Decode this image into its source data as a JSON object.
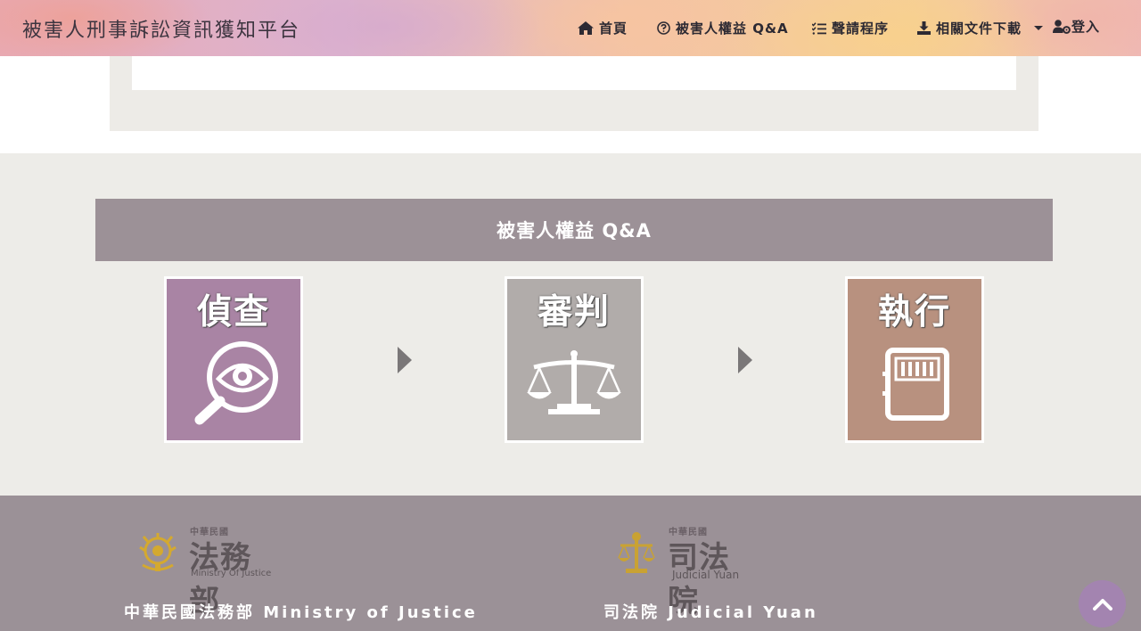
{
  "brand": "被害人刑事訴訟資訊獲知平台",
  "nav": {
    "home": "首頁",
    "qa": "被害人權益 Q&A",
    "apply": "聲請程序",
    "downloads": "相關文件下載",
    "login": "登入"
  },
  "section": {
    "title": "被害人權益 Q&A",
    "stages": [
      {
        "label": "偵查",
        "color": "#a984a4",
        "icon": "magnifier-eye-icon"
      },
      {
        "label": "審判",
        "color": "#b1acaa",
        "icon": "scales-icon"
      },
      {
        "label": "執行",
        "color": "#b8917f",
        "icon": "prison-door-icon"
      }
    ]
  },
  "footer": {
    "moj": {
      "logo_small": "中華民國",
      "logo_big": "法務部",
      "logo_en": "Ministry Of Justice",
      "name": "中華民國法務部 Ministry of Justice"
    },
    "jy": {
      "logo_small": "中華民國",
      "logo_big": "司法院",
      "logo_en": "Judicial Yuan",
      "name": "司法院 Judicial Yuan"
    }
  },
  "icons": {
    "home": "home-icon",
    "question": "question-circle-icon",
    "list": "checklist-icon",
    "download": "download-icon",
    "user": "user-gear-icon",
    "to_top": "chevron-up-icon"
  }
}
